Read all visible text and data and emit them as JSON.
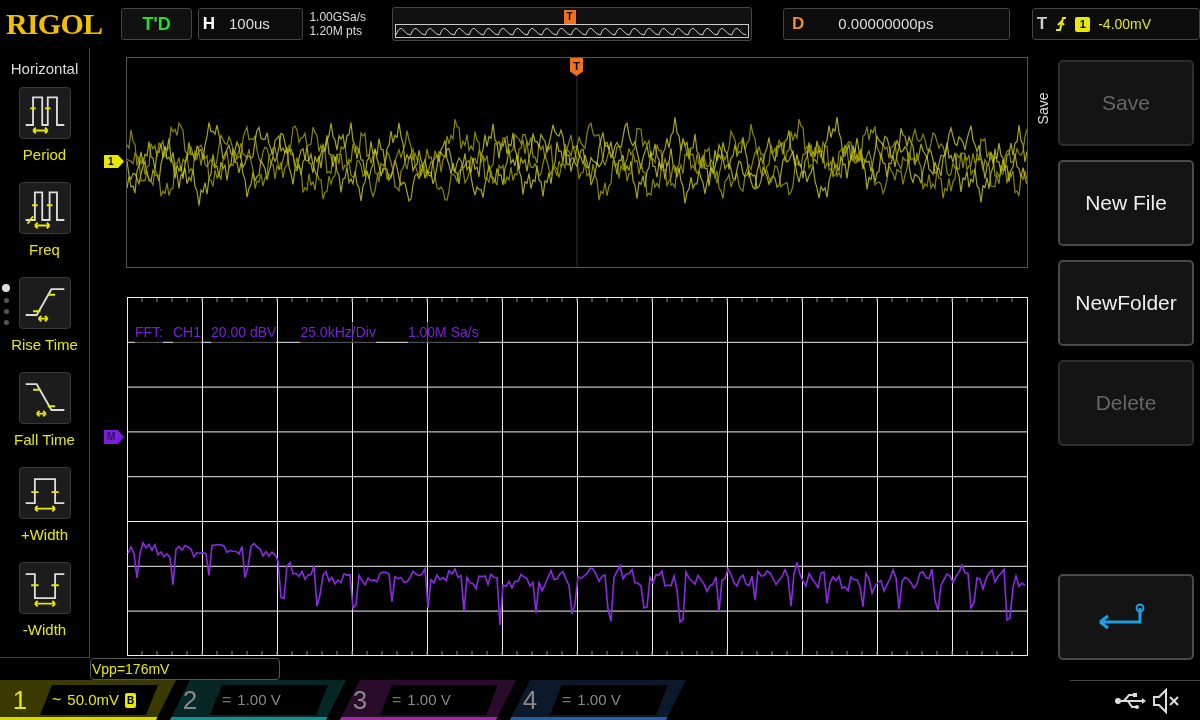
{
  "brand": "RIGOL",
  "run_state": "T'D",
  "horizontal": {
    "label": "H",
    "value": "100us"
  },
  "sample_rate": "1.00GSa/s",
  "memory_depth": "1.20M pts",
  "timeline_trigger_marker": "T",
  "delay": {
    "label": "D",
    "value": "0.00000000ps"
  },
  "trigger": {
    "label": "T",
    "source": "1",
    "level": "-4.00mV"
  },
  "left_menu": {
    "title": "Horizontal",
    "items": [
      {
        "label": "Period",
        "kind": "period"
      },
      {
        "label": "Freq",
        "kind": "freq"
      },
      {
        "label": "Rise Time",
        "kind": "rise"
      },
      {
        "label": "Fall Time",
        "kind": "fall"
      },
      {
        "label": "+Width",
        "kind": "pwidth"
      },
      {
        "label": "-Width",
        "kind": "nwidth"
      }
    ]
  },
  "menu_pages": [
    {
      "selected": true
    },
    {
      "selected": false
    },
    {
      "selected": false
    },
    {
      "selected": false
    }
  ],
  "display": {
    "trigger_marker": "T",
    "channel_marker": "1",
    "math_marker": "M",
    "fft_info": [
      "FFT:",
      "CH1",
      "20.00 dBV",
      "25.0kHz/Div",
      "1.00M Sa/s"
    ]
  },
  "measurement": "Vpp=176mV",
  "right_menu": {
    "title": "Save",
    "items": [
      {
        "kind": "text",
        "label": "Save",
        "disabled": true
      },
      {
        "kind": "text",
        "label": "New File",
        "disabled": false
      },
      {
        "kind": "text",
        "label": "NewFolder",
        "disabled": false
      },
      {
        "kind": "text",
        "label": "Delete",
        "disabled": true
      },
      {
        "kind": "enter",
        "disabled": false
      }
    ]
  },
  "channels": [
    {
      "number": "1",
      "coupling": "~",
      "scale": "50.0mV",
      "bandwidth_limit": "B",
      "on": true,
      "color": "#d8d800"
    },
    {
      "number": "2",
      "coupling": "=",
      "scale": "1.00 V",
      "on": false,
      "color": "#1a8f8f"
    },
    {
      "number": "3",
      "coupling": "=",
      "scale": "1.00 V",
      "on": false,
      "color": "#a02aa0"
    },
    {
      "number": "4",
      "coupling": "=",
      "scale": "1.00 V",
      "on": false,
      "color": "#2a5f9f"
    }
  ],
  "sound_muted": true
}
